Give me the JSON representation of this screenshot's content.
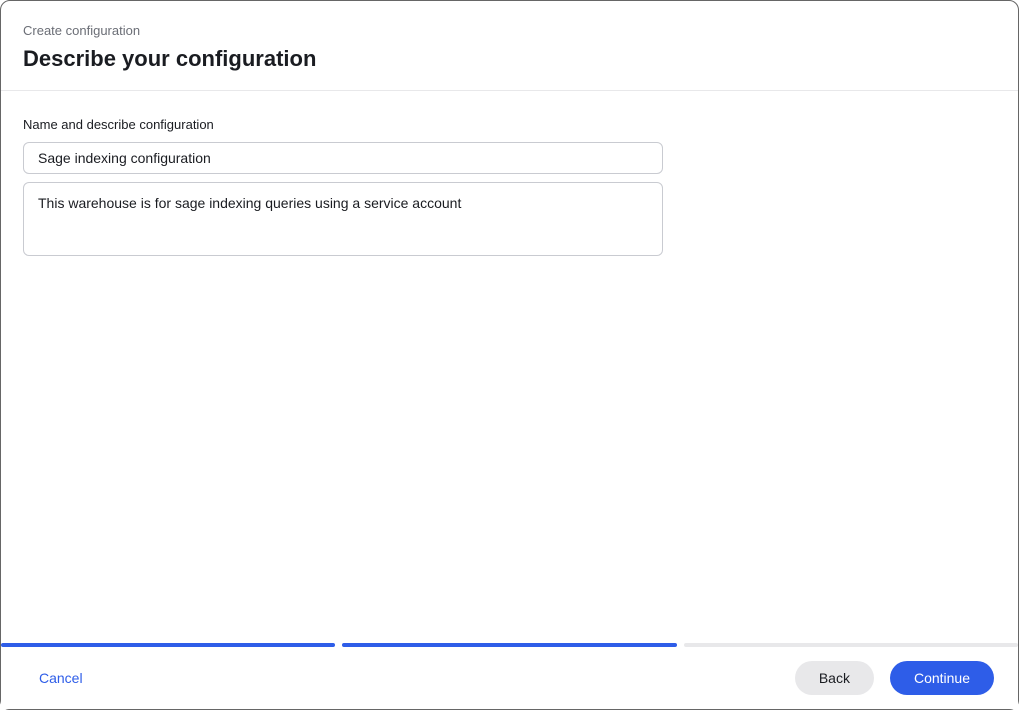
{
  "header": {
    "breadcrumb": "Create configuration",
    "title": "Describe your configuration"
  },
  "form": {
    "section_label": "Name and describe configuration",
    "name_value": "Sage indexing configuration",
    "description_value": "This warehouse is for sage indexing queries using a service account"
  },
  "progress": {
    "segments": [
      {
        "filled": true
      },
      {
        "filled": true
      },
      {
        "filled": false
      }
    ]
  },
  "footer": {
    "cancel_label": "Cancel",
    "back_label": "Back",
    "continue_label": "Continue"
  }
}
